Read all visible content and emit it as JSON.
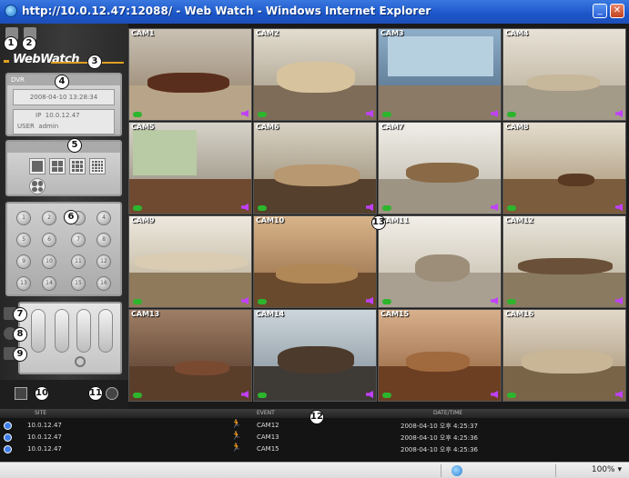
{
  "window": {
    "title": "http://10.0.12.47:12088/ - Web Watch - Windows Internet Explorer",
    "min_label": "_",
    "max_label": "□",
    "close_label": "✕"
  },
  "app": {
    "logo": "WebWatch",
    "dvr": {
      "header": "DVR",
      "datetime": "2008-04-10 13:28:34",
      "ip_label": "IP",
      "ip": "10.0.12.47",
      "user_label": "USER",
      "user": "admin"
    },
    "layout_header": "LAYOUT",
    "channels": [
      "1",
      "2",
      "3",
      "4",
      "5",
      "6",
      "7",
      "8",
      "9",
      "10",
      "11",
      "12",
      "13",
      "14",
      "15",
      "16"
    ],
    "cameras": [
      "CAM1",
      "CAM2",
      "CAM3",
      "CAM4",
      "CAM5",
      "CAM6",
      "CAM7",
      "CAM8",
      "CAM9",
      "CAM10",
      "CAM11",
      "CAM12",
      "CAM13",
      "CAM14",
      "CAM15",
      "CAM16"
    ]
  },
  "callouts": [
    "1",
    "2",
    "3",
    "4",
    "5",
    "6",
    "7",
    "8",
    "9",
    "10",
    "11",
    "12",
    "13"
  ],
  "eventlog": {
    "col_site": "SITE",
    "col_event": "EVENT",
    "col_datetime": "DATE/TIME",
    "rows": [
      {
        "site": "10.0.12.47",
        "event": "CAM12",
        "datetime": "2008-04-10 오후 4:25:37"
      },
      {
        "site": "10.0.12.47",
        "event": "CAM13",
        "datetime": "2008-04-10 오후 4:25:36"
      },
      {
        "site": "10.0.12.47",
        "event": "CAM15",
        "datetime": "2008-04-10 오후 4:25:36"
      }
    ]
  },
  "statusbar": {
    "zoom": "100%",
    "zoom_arrow": "▾"
  }
}
